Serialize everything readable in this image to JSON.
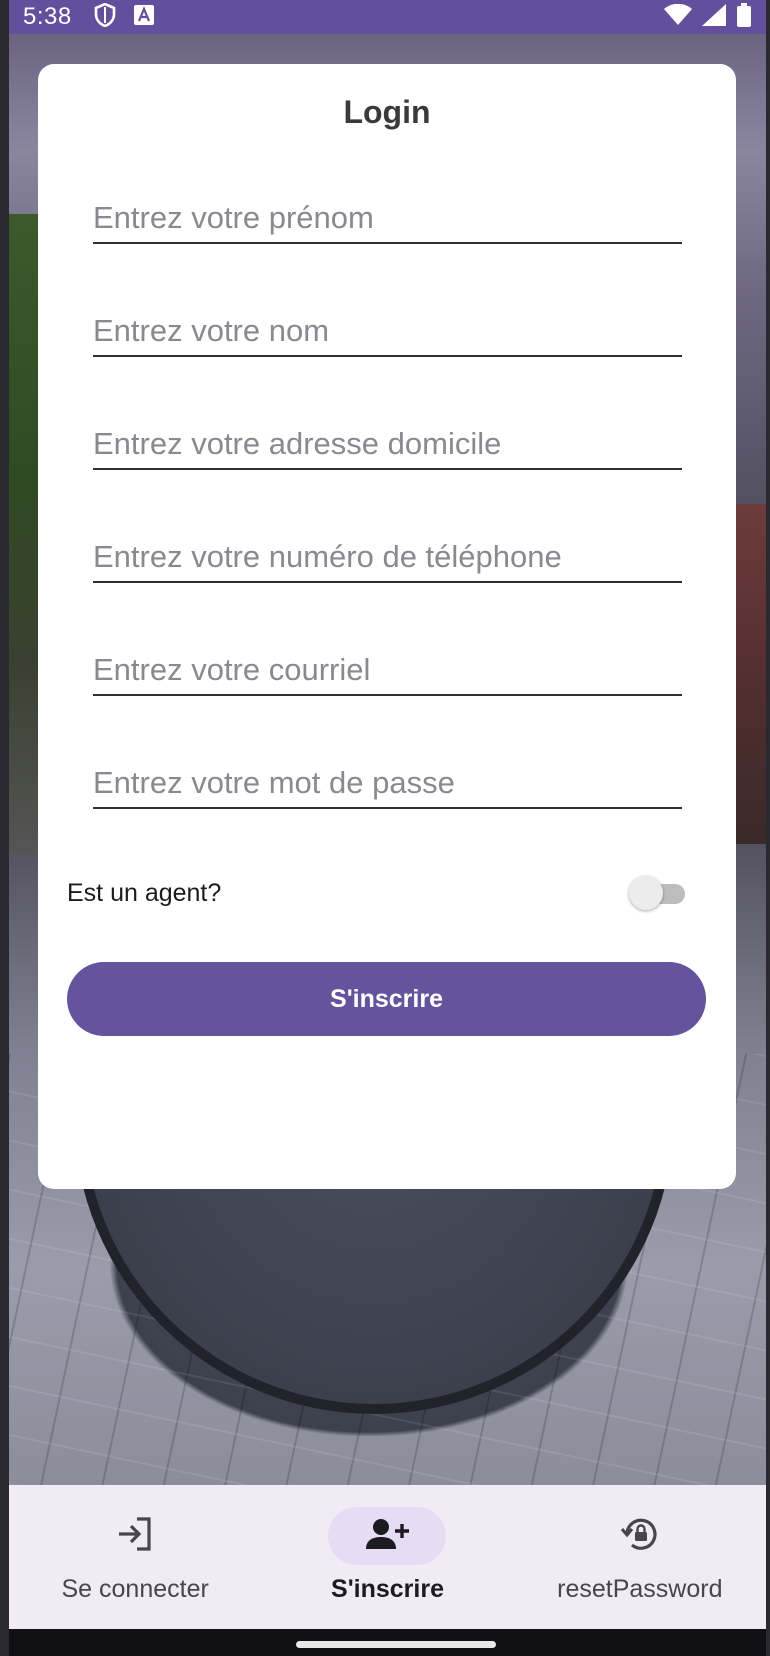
{
  "status_bar": {
    "time": "5:38",
    "left_icons": [
      "shield-icon",
      "font-a-icon"
    ],
    "right_icons": [
      "wifi-icon",
      "signal-icon",
      "battery-icon"
    ],
    "color": "#634f9c"
  },
  "card": {
    "title": "Login",
    "fields": [
      {
        "placeholder": "Entrez votre prénom",
        "value": ""
      },
      {
        "placeholder": "Entrez votre nom",
        "value": ""
      },
      {
        "placeholder": "Entrez votre adresse domicile",
        "value": ""
      },
      {
        "placeholder": "Entrez votre numéro de téléphone",
        "value": ""
      },
      {
        "placeholder": "Entrez votre courriel",
        "value": ""
      },
      {
        "placeholder": "Entrez votre mot de passe",
        "value": ""
      }
    ],
    "switch": {
      "label": "Est un agent?",
      "checked": false
    },
    "submit_label": "S'inscrire",
    "accent_color": "#65539d"
  },
  "bottom_nav": {
    "items": [
      {
        "label": "Se connecter",
        "icon": "login-icon",
        "active": false
      },
      {
        "label": "S'inscrire",
        "icon": "person-add-icon",
        "active": true
      },
      {
        "label": "resetPassword",
        "icon": "lock-reset-icon",
        "active": false
      }
    ],
    "background": "#f0ebf5",
    "active_pill": "#e6dcf3"
  }
}
